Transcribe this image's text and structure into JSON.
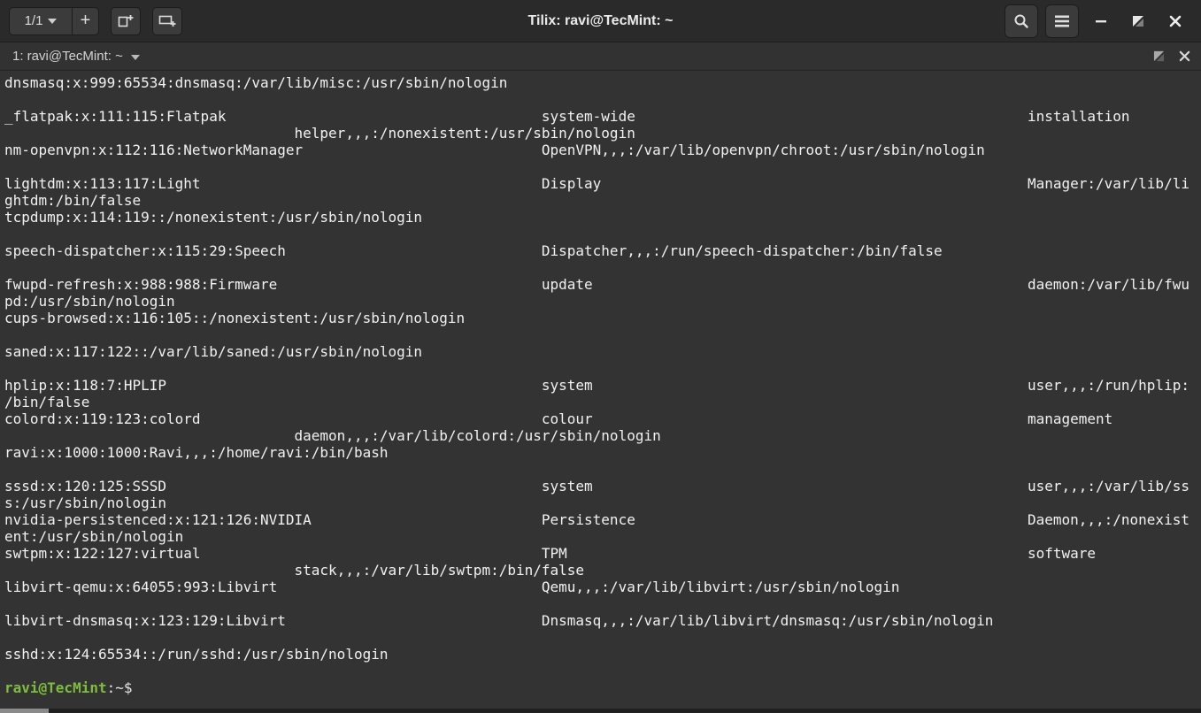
{
  "window": {
    "title": "Tilix: ravi@TecMint: ~"
  },
  "header": {
    "session_indicator": "1/1",
    "new_terminal_label": "+",
    "icons": [
      "add-terminal-right",
      "add-terminal-down",
      "search",
      "menu",
      "minimize",
      "restore",
      "close"
    ]
  },
  "tab_bar": {
    "title": "1: ravi@TecMint: ~"
  },
  "terminal": {
    "lines": [
      "dnsmasq:x:999:65534:dnsmasq:/var/lib/misc:/usr/sbin/nologin",
      "",
      "_flatpak:x:111:115:Flatpak                                     system-wide                                              installation",
      "                                  helper,,,:/nonexistent:/usr/sbin/nologin",
      "nm-openvpn:x:112:116:NetworkManager                            OpenVPN,,,:/var/lib/openvpn/chroot:/usr/sbin/nologin",
      "",
      "lightdm:x:113:117:Light                                        Display                                                  Manager:/var/lib/li",
      "ghtdm:/bin/false",
      "tcpdump:x:114:119::/nonexistent:/usr/sbin/nologin",
      "",
      "speech-dispatcher:x:115:29:Speech                              Dispatcher,,,:/run/speech-dispatcher:/bin/false",
      "",
      "fwupd-refresh:x:988:988:Firmware                               update                                                   daemon:/var/lib/fwu",
      "pd:/usr/sbin/nologin",
      "cups-browsed:x:116:105::/nonexistent:/usr/sbin/nologin",
      "",
      "saned:x:117:122::/var/lib/saned:/usr/sbin/nologin",
      "",
      "hplip:x:118:7:HPLIP                                            system                                                   user,,,:/run/hplip:",
      "/bin/false",
      "colord:x:119:123:colord                                        colour                                                   management",
      "                                  daemon,,,:/var/lib/colord:/usr/sbin/nologin",
      "ravi:x:1000:1000:Ravi,,,:/home/ravi:/bin/bash",
      "",
      "sssd:x:120:125:SSSD                                            system                                                   user,,,:/var/lib/ss",
      "s:/usr/sbin/nologin",
      "nvidia-persistenced:x:121:126:NVIDIA                           Persistence                                              Daemon,,,:/nonexist",
      "ent:/usr/sbin/nologin",
      "swtpm:x:122:127:virtual                                        TPM                                                      software",
      "                                  stack,,,:/var/lib/swtpm:/bin/false",
      "libvirt-qemu:x:64055:993:Libvirt                               Qemu,,,:/var/lib/libvirt:/usr/sbin/nologin",
      "",
      "libvirt-dnsmasq:x:123:129:Libvirt                              Dnsmasq,,,:/var/lib/libvirt/dnsmasq:/usr/sbin/nologin",
      "",
      "sshd:x:124:65534::/run/sshd:/usr/sbin/nologin",
      ""
    ],
    "prompt": {
      "user_host": "ravi@TecMint",
      "suffix": ":~$ "
    }
  },
  "colors": {
    "terminal_bg": "#333333",
    "titlebar_bg": "#2a2a2a",
    "button_bg": "#3b3b3b",
    "text": "#f1f1f1",
    "prompt_green": "#7dbe3b"
  }
}
